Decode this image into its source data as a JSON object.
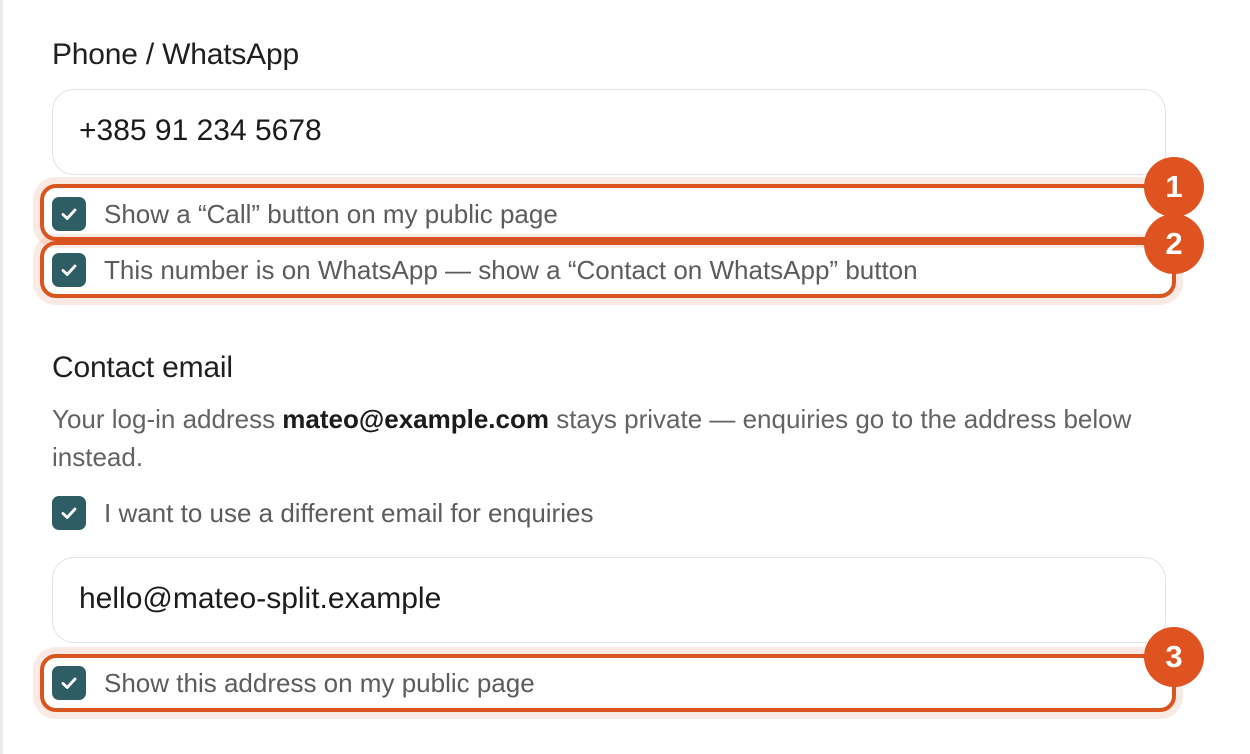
{
  "phone": {
    "label": "Phone / WhatsApp",
    "value": "+385 91 234 5678",
    "call_checkbox": {
      "label": "Show a “Call” button on my public page",
      "checked": true
    },
    "whatsapp_checkbox": {
      "label": "This number is on WhatsApp — show a “Contact on WhatsApp” button",
      "checked": true
    }
  },
  "email": {
    "label": "Contact email",
    "helper_before": "Your log-in address ",
    "helper_email": "mateo@example.com",
    "helper_after": " stays private — enquiries go to the address below instead.",
    "different_email_checkbox": {
      "label": "I want to use a different email for enquiries",
      "checked": true
    },
    "value": "hello@mateo-split.example",
    "show_address_checkbox": {
      "label": "Show this address on my public page",
      "checked": true
    }
  },
  "annotations": [
    "1",
    "2",
    "3"
  ],
  "colors": {
    "checkbox": "#2f5d66",
    "highlight": "#d9541f",
    "badge": "#df5320"
  }
}
